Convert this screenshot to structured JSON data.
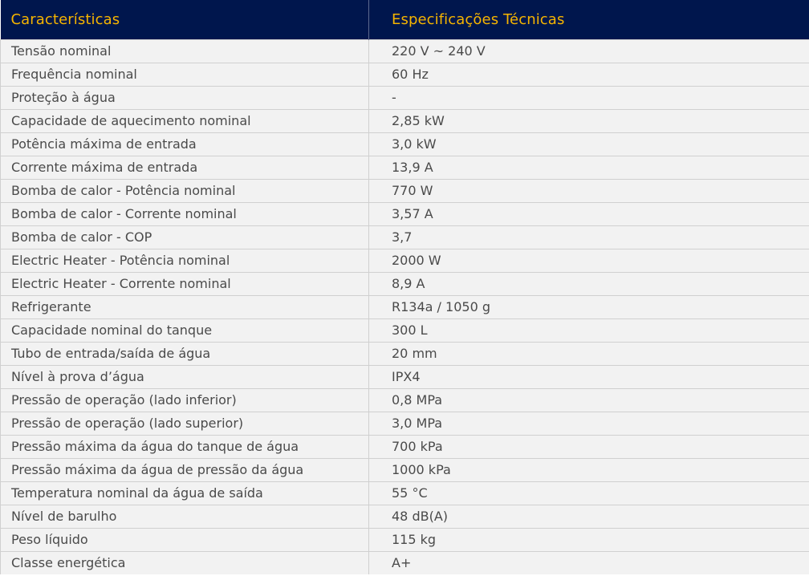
{
  "table": {
    "headers": [
      "Características",
      "Especificações Técnicas"
    ],
    "rows": [
      [
        "Tensão nominal",
        "220 V ~ 240 V"
      ],
      [
        "Frequência nominal",
        "60 Hz"
      ],
      [
        "Proteção à água",
        "-"
      ],
      [
        "Capacidade de aquecimento nominal",
        "2,85 kW"
      ],
      [
        "Potência máxima de entrada",
        "3,0 kW"
      ],
      [
        "Corrente máxima de entrada",
        "13,9 A"
      ],
      [
        "Bomba de calor - Potência nominal",
        "770 W"
      ],
      [
        "Bomba de calor - Corrente nominal",
        "3,57 A"
      ],
      [
        "Bomba de calor - COP",
        "3,7"
      ],
      [
        "Electric Heater - Potência nominal",
        "2000 W"
      ],
      [
        "Electric Heater - Corrente nominal",
        "8,9 A"
      ],
      [
        "Refrigerante",
        "R134a / 1050 g"
      ],
      [
        "Capacidade nominal do tanque",
        "300 L"
      ],
      [
        "Tubo de entrada/saída de água",
        "20 mm"
      ],
      [
        "Nível à prova d’água",
        "IPX4"
      ],
      [
        "Pressão de operação (lado inferior)",
        "0,8 MPa"
      ],
      [
        "Pressão de operação (lado superior)",
        "3,0 MPa"
      ],
      [
        "Pressão máxima da água do tanque de água",
        "700 kPa"
      ],
      [
        "Pressão máxima da água de pressão da água",
        "1000 kPa"
      ],
      [
        "Temperatura nominal da água de saída",
        "55 °C"
      ],
      [
        "Nível de barulho",
        "48 dB(A)"
      ],
      [
        "Peso líquido",
        "115 kg"
      ],
      [
        "Classe energética",
        "A+"
      ]
    ]
  },
  "colors": {
    "header_bg": "#00164d",
    "header_text": "#f5b400",
    "row_bg": "#f2f2f2",
    "body_text": "#4a4a4a",
    "border": "#d0d0d0"
  }
}
